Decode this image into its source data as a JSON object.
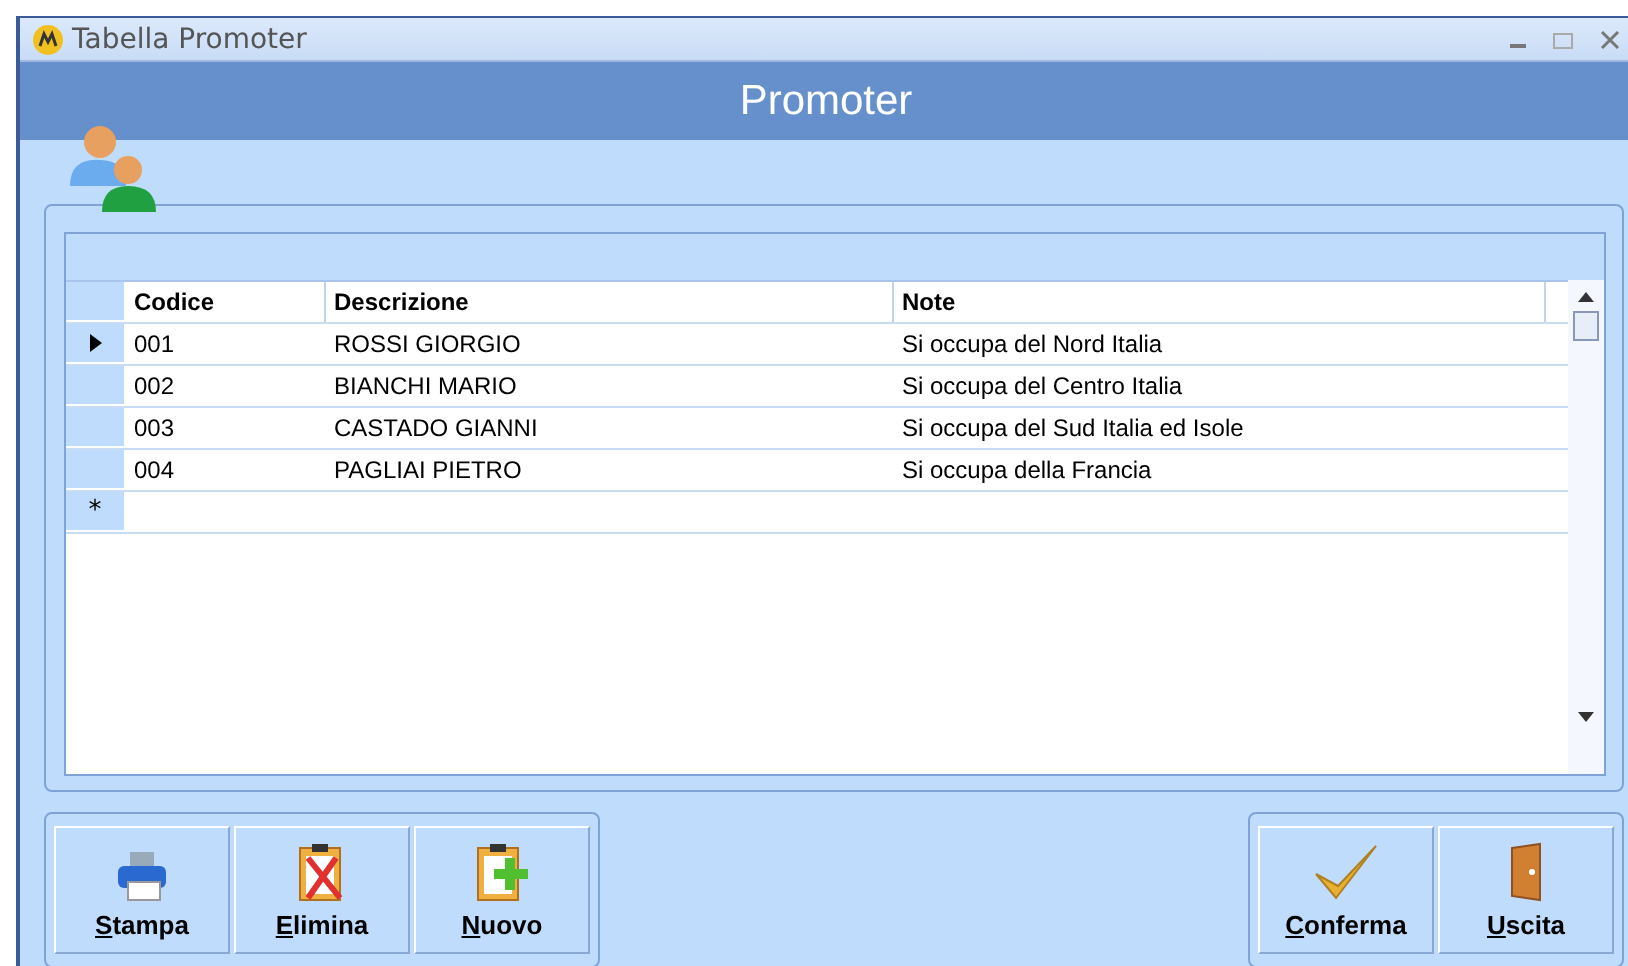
{
  "window": {
    "title": "Tabella Promoter"
  },
  "header": {
    "title": "Promoter"
  },
  "grid": {
    "columns": [
      "Codice",
      "Descrizione",
      "Note"
    ],
    "rows": [
      {
        "cells": [
          "001",
          "ROSSI GIORGIO",
          "Si occupa del Nord Italia"
        ],
        "selected": true
      },
      {
        "cells": [
          "002",
          "BIANCHI MARIO",
          "Si occupa del Centro Italia"
        ],
        "selected": false
      },
      {
        "cells": [
          "003",
          "CASTADO GIANNI",
          "Si occupa del Sud Italia ed Isole"
        ],
        "selected": false
      },
      {
        "cells": [
          "004",
          "PAGLIAI PIETRO",
          "Si occupa della Francia"
        ],
        "selected": false
      }
    ],
    "new_row_marker": "*"
  },
  "left_buttons": [
    {
      "label": "Stampa",
      "kind": "print"
    },
    {
      "label": "Elimina",
      "kind": "delete"
    },
    {
      "label": "Nuovo",
      "kind": "new"
    }
  ],
  "right_buttons": [
    {
      "label": "Conferma",
      "kind": "confirm"
    },
    {
      "label": "Uscita",
      "kind": "exit"
    }
  ]
}
